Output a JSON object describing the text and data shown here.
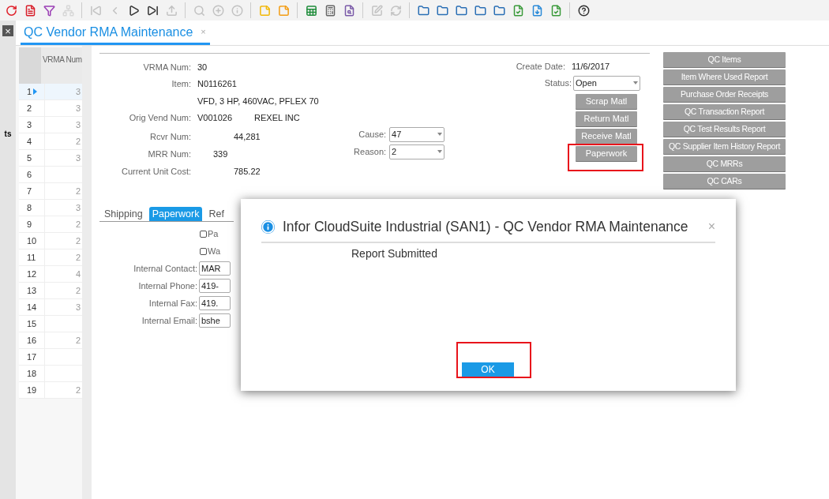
{
  "toolbar": [
    {
      "kind": "refresh",
      "disabled": false
    },
    {
      "kind": "doc-red",
      "disabled": false
    },
    {
      "kind": "filter",
      "disabled": false
    },
    {
      "kind": "hierarchy",
      "disabled": true
    },
    {
      "kind": "sep"
    },
    {
      "kind": "first",
      "disabled": true
    },
    {
      "kind": "prev",
      "disabled": true
    },
    {
      "kind": "next",
      "disabled": false
    },
    {
      "kind": "last",
      "disabled": false
    },
    {
      "kind": "upload",
      "disabled": true
    },
    {
      "kind": "sep"
    },
    {
      "kind": "search",
      "disabled": true
    },
    {
      "kind": "plus",
      "disabled": true
    },
    {
      "kind": "info",
      "disabled": true
    },
    {
      "kind": "sep"
    },
    {
      "kind": "note-yellow",
      "disabled": false
    },
    {
      "kind": "note-orange",
      "disabled": false
    },
    {
      "kind": "sep"
    },
    {
      "kind": "excel",
      "disabled": false
    },
    {
      "kind": "calc",
      "disabled": false
    },
    {
      "kind": "preview",
      "disabled": false
    },
    {
      "kind": "sep"
    },
    {
      "kind": "edit",
      "disabled": true
    },
    {
      "kind": "sync",
      "disabled": true
    },
    {
      "kind": "sep"
    },
    {
      "kind": "folder",
      "disabled": false
    },
    {
      "kind": "folder",
      "disabled": false
    },
    {
      "kind": "folder",
      "disabled": false
    },
    {
      "kind": "folder",
      "disabled": false
    },
    {
      "kind": "folder",
      "disabled": false
    },
    {
      "kind": "doc-green",
      "disabled": false
    },
    {
      "kind": "download",
      "disabled": false
    },
    {
      "kind": "doc-green",
      "disabled": false
    },
    {
      "kind": "sep"
    },
    {
      "kind": "help",
      "disabled": false
    }
  ],
  "side_strip": {
    "close": "×",
    "label": "ts"
  },
  "tabs": [
    {
      "label": "QC Vendor RMA Maintenance",
      "close": "×",
      "selected": true
    }
  ],
  "grid": {
    "column": "VRMA Num",
    "rows": [
      {
        "num": "1",
        "value": "3",
        "selected": true
      },
      {
        "num": "2",
        "value": "3",
        "selected": false
      },
      {
        "num": "3",
        "value": "3",
        "selected": false
      },
      {
        "num": "4",
        "value": "2",
        "selected": false
      },
      {
        "num": "5",
        "value": "3",
        "selected": false
      },
      {
        "num": "6",
        "selected": false
      },
      {
        "num": "7",
        "value": "2",
        "selected": false
      },
      {
        "num": "8",
        "value": "3",
        "selected": false
      },
      {
        "num": "9",
        "value": "2",
        "selected": false
      },
      {
        "num": "10",
        "value": "2",
        "selected": false
      },
      {
        "num": "11",
        "value": "2",
        "selected": false
      },
      {
        "num": "12",
        "value": "4",
        "selected": false
      },
      {
        "num": "13",
        "value": "2",
        "selected": false
      },
      {
        "num": "14",
        "value": "3",
        "selected": false
      },
      {
        "num": "15",
        "selected": false
      },
      {
        "num": "16",
        "value": "2",
        "selected": false
      },
      {
        "num": "17",
        "selected": false
      },
      {
        "num": "18",
        "selected": false
      },
      {
        "num": "19",
        "value": "2",
        "selected": false
      }
    ]
  },
  "form": {
    "fields": [
      {
        "label": "VRMA Num:",
        "value": "30"
      },
      {
        "label": "Item:",
        "value": "N0116261"
      },
      {
        "value": "VFD, 3 HP, 460VAC, PFLEX 70"
      },
      {
        "label": "Orig Vend Num:",
        "value": "V001026",
        "extra": "REXEL INC"
      },
      {
        "label": "Rcvr Num:",
        "value": "44,281"
      },
      {
        "label": "MRR Num:",
        "value": "339"
      },
      {
        "label": "Current Unit Cost:",
        "value": "785.22"
      }
    ],
    "selects": [
      {
        "label": "Cause:",
        "value": "47"
      },
      {
        "label": "Reason:",
        "value": "2"
      }
    ],
    "create_date": {
      "label": "Create Date:",
      "value": "11/6/2017"
    },
    "status": {
      "label": "Status:",
      "value": "Open"
    },
    "action_buttons": [
      "Scrap Matl",
      "Return Matl",
      "Receive Matl",
      "Paperwork"
    ],
    "report_buttons": [
      "QC Items",
      "Item Where Used Report",
      "Purchase Order Receipts",
      "QC Transaction Report",
      "QC Test Results Report",
      "QC Supplier Item History Report",
      "QC MRRs",
      "QC CARs"
    ]
  },
  "subtabs": [
    {
      "label": "Shipping",
      "selected": false
    },
    {
      "label": "Paperwork",
      "selected": true
    },
    {
      "label": "Ref",
      "selected": false
    }
  ],
  "paperwork": {
    "checkboxes": [
      {
        "label": "Pa",
        "checked": false
      },
      {
        "label": "Wa",
        "checked": false
      }
    ],
    "fields": [
      {
        "label": "Internal Contact:",
        "value": "MAR"
      },
      {
        "label": "Internal Phone:",
        "value": "419-"
      },
      {
        "label": "Internal Fax:",
        "value": "419."
      },
      {
        "label": "Internal Email:",
        "value": "bshe"
      }
    ]
  },
  "dialog": {
    "title": "Infor CloudSuite Industrial (SAN1) - QC Vendor RMA Maintenance",
    "close": "×",
    "message": "Report Submitted",
    "button": "OK"
  }
}
